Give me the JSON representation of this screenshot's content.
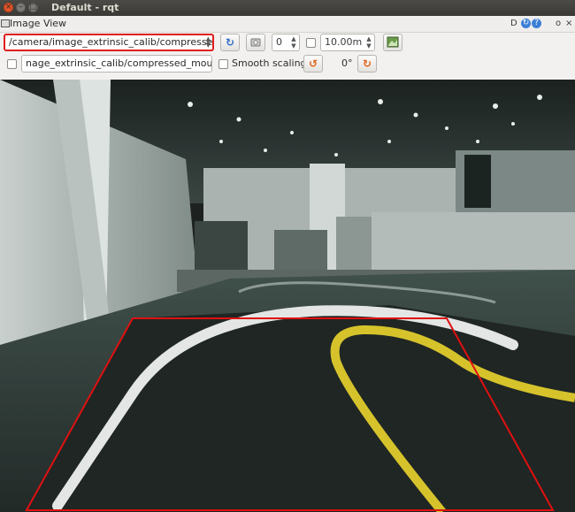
{
  "window": {
    "title": "Default - rqt",
    "close_glyph": "×",
    "min_glyph": "–",
    "max_glyph": "□"
  },
  "dock": {
    "title": "Image View",
    "d_label": "D",
    "o_label": "o",
    "close_label": "×",
    "reload_glyph": "↻",
    "help_glyph": "?"
  },
  "toolbar": {
    "topic": "/camera/image_extrinsic_calib/compressed",
    "refresh_glyph": "↻",
    "zoom_value": "0",
    "distance_value": "10.00m",
    "mouse_topic": "nage_extrinsic_calib/compressed_mouse_left",
    "smooth_scaling_label": "Smooth scaling",
    "rotate_left_glyph": "↺",
    "rotation_value": "0°",
    "rotate_right_glyph": "↻",
    "spin_up": "▲",
    "spin_down": "▼"
  },
  "colors": {
    "overlay_line": "#e01010",
    "lane_white": "#e6e8e6",
    "lane_yellow": "#d8c42a",
    "track": "#222826",
    "floor": "#3a4844"
  },
  "icons": {
    "refresh": "refresh-icon",
    "snapshot": "camera-icon",
    "save": "save-image-icon",
    "rotate_left": "rotate-left-icon",
    "rotate_right": "rotate-right-icon"
  },
  "overlay": {
    "shape": "trapezoid"
  }
}
